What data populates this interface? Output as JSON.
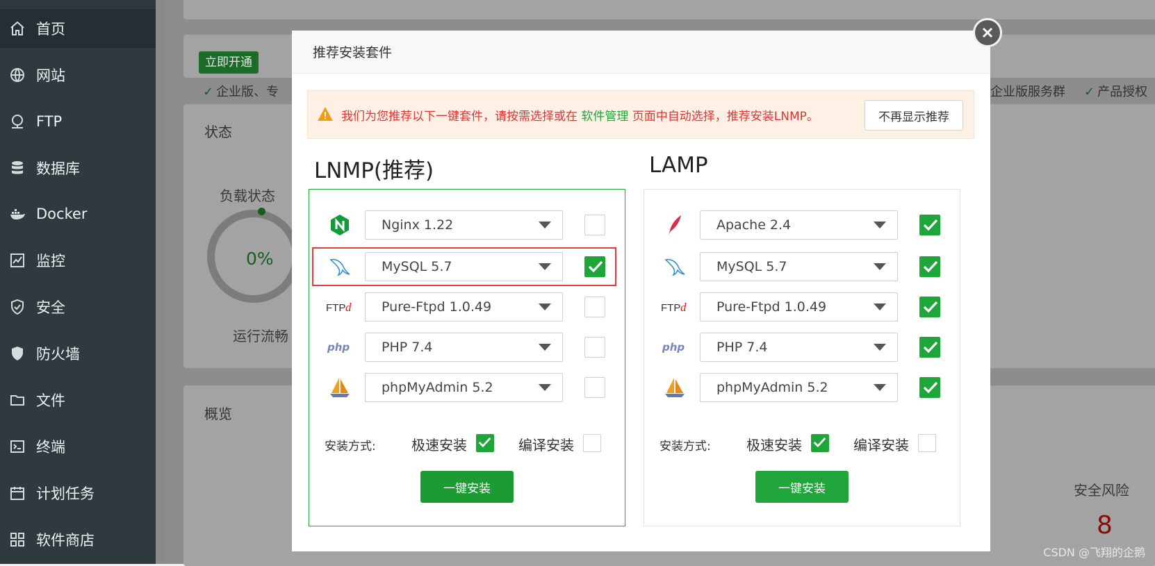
{
  "sidebar": {
    "items": [
      {
        "label": "首页",
        "icon": "home-icon",
        "active": true
      },
      {
        "label": "网站",
        "icon": "globe-icon"
      },
      {
        "label": "FTP",
        "icon": "ftp-icon"
      },
      {
        "label": "数据库",
        "icon": "database-icon"
      },
      {
        "label": "Docker",
        "icon": "docker-icon"
      },
      {
        "label": "监控",
        "icon": "monitor-icon"
      },
      {
        "label": "安全",
        "icon": "shield-check-icon"
      },
      {
        "label": "防火墙",
        "icon": "firewall-shield-icon"
      },
      {
        "label": "文件",
        "icon": "folder-icon"
      },
      {
        "label": "终端",
        "icon": "terminal-icon"
      },
      {
        "label": "计划任务",
        "icon": "calendar-icon"
      },
      {
        "label": "软件商店",
        "icon": "apps-grid-icon"
      }
    ]
  },
  "background": {
    "activate_button": "立即开通",
    "features_left": "企业版、专",
    "features_right_1": "企业版服务群",
    "features_right_2": "产品授权",
    "status_title": "状态",
    "load_label": "负载状态",
    "load_value": "0%",
    "load_status": "运行流畅",
    "overview_title": "概览",
    "risk_label": "安全风险",
    "risk_value": "8",
    "watermark": "CSDN @飞翔的企鹅"
  },
  "modal": {
    "title": "推荐安装套件",
    "alert": {
      "text_before": "我们为您推荐以下一键套件，请按需选择或在",
      "link": "软件管理",
      "text_after": "页面中自动选择，推荐安装LNMP。",
      "dismiss_button": "不再显示推荐"
    },
    "lnmp": {
      "title": "LNMP(推荐)",
      "rows": [
        {
          "software": "Nginx 1.22",
          "icon": "nginx-icon",
          "checked": false
        },
        {
          "software": "MySQL 5.7",
          "icon": "mysql-dolphin-icon",
          "checked": true
        },
        {
          "software": "Pure-Ftpd 1.0.49",
          "icon": "ftpd-icon",
          "checked": false
        },
        {
          "software": "PHP 7.4",
          "icon": "php-icon",
          "checked": false
        },
        {
          "software": "phpMyAdmin 5.2",
          "icon": "phpmyadmin-sailboat-icon",
          "checked": false
        }
      ],
      "install_method_label": "安装方式:",
      "fast_install": "极速安装",
      "compile_install": "编译安装",
      "install_button": "一键安装"
    },
    "lamp": {
      "title": "LAMP",
      "rows": [
        {
          "software": "Apache 2.4",
          "icon": "apache-feather-icon",
          "checked": true
        },
        {
          "software": "MySQL 5.7",
          "icon": "mysql-dolphin-icon",
          "checked": true
        },
        {
          "software": "Pure-Ftpd 1.0.49",
          "icon": "ftpd-icon",
          "checked": true
        },
        {
          "software": "PHP 7.4",
          "icon": "php-icon",
          "checked": true
        },
        {
          "software": "phpMyAdmin 5.2",
          "icon": "phpmyadmin-sailboat-icon",
          "checked": true
        }
      ],
      "install_method_label": "安装方式:",
      "fast_install": "极速安装",
      "compile_install": "编译安装",
      "install_button": "一键安装"
    }
  },
  "colors": {
    "accent_green": "#20a53a",
    "alert_red": "#e23434",
    "sidebar_bg": "#2f3a3f"
  }
}
